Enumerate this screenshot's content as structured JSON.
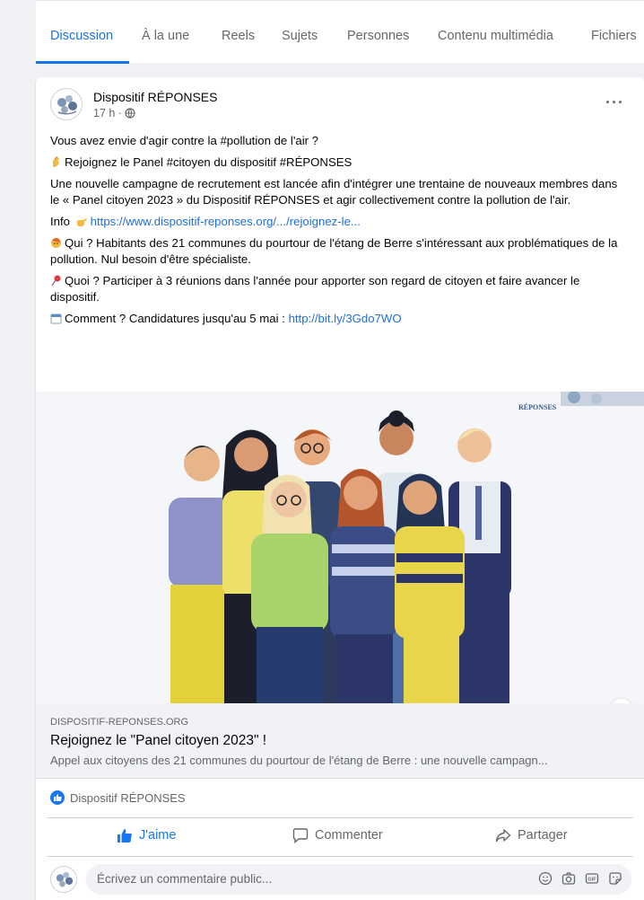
{
  "tabs": [
    {
      "label": "Discussion",
      "active": true
    },
    {
      "label": "À la une"
    },
    {
      "label": "Reels"
    },
    {
      "label": "Sujets"
    },
    {
      "label": "Personnes"
    },
    {
      "label": "Contenu multimédia"
    },
    {
      "label": "Fichiers"
    }
  ],
  "post": {
    "author": "Dispositif RÉPONSES",
    "time": "17 h ·",
    "more_label": "···",
    "lines": {
      "l1": "Vous avez envie d'agir contre la #pollution de l'air ?",
      "l2": "Rejoignez le Panel #citoyen du dispositif #RÉPONSES",
      "l3": "Une nouvelle campagne de recrutement est lancée afin d'intégrer une trentaine de nouveaux membres dans le « Panel citoyen 2023 » du Dispositif RÉPONSES et agir collectivement contre la pollution de l'air.",
      "l4_prefix": "Info",
      "l4_link": "https://www.dispositif-reponses.org/.../rejoignez-le...",
      "l5": "Qui ? Habitants des 21 communes du pourtour de l'étang de Berre s'intéressant aux problématiques de la pollution. Nul besoin d'être spécialiste.",
      "l6": "Quoi ? Participer à 3 réunions dans l'année pour apporter son regard de citoyen et faire avancer le dispositif.",
      "l7_prefix": "Comment ? Candidatures jusqu'au 5 mai :",
      "l7_link": "http://bit.ly/3Gdo7WO"
    },
    "image_logo_text": "RÉPONSES",
    "info_label": "i"
  },
  "link_preview": {
    "domain": "DISPOSITIF-REPONSES.ORG",
    "title": "Rejoignez le \"Panel citoyen 2023\" !",
    "description": "Appel aux citoyens des 21 communes du pourtour de l'étang de Berre : une nouvelle campagn..."
  },
  "reactions": {
    "label": "Dispositif RÉPONSES"
  },
  "actions": {
    "like": "J'aime",
    "comment": "Commenter",
    "share": "Partager"
  },
  "comment": {
    "placeholder": "Écrivez un commentaire public..."
  },
  "colors": {
    "accent": "#1b74e4",
    "like_blue": "#1877f2",
    "link": "#216fdb"
  }
}
